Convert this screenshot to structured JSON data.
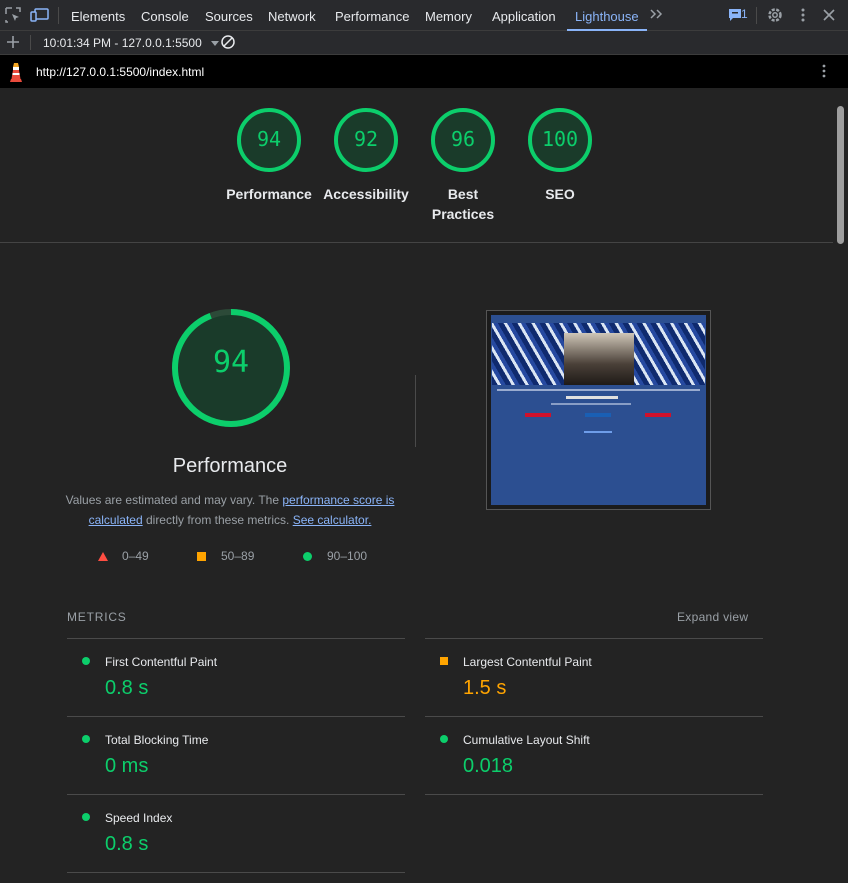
{
  "toolbar": {
    "tabs": [
      "Elements",
      "Console",
      "Sources",
      "Network",
      "Performance",
      "Memory",
      "Application",
      "Lighthouse"
    ],
    "active_tab": "Lighthouse",
    "issues_count": "1"
  },
  "report_bar": {
    "selected_report": "10:01:34 PM - 127.0.0.1:5500"
  },
  "url_bar": {
    "url": "http://127.0.0.1:5500/index.html"
  },
  "summary_scores": [
    {
      "score": "94",
      "label": "Performance",
      "label2": ""
    },
    {
      "score": "92",
      "label": "Accessibility",
      "label2": ""
    },
    {
      "score": "96",
      "label": "Best",
      "label2": "Practices"
    },
    {
      "score": "100",
      "label": "SEO",
      "label2": ""
    }
  ],
  "performance": {
    "score": "94",
    "score_fraction": 0.94,
    "title": "Performance",
    "desc_prefix": "Values are estimated and may vary. The ",
    "desc_link1": "performance score is calculated",
    "desc_middle": " directly from these metrics. ",
    "desc_link2": "See calculator."
  },
  "legend": {
    "fail": "0–49",
    "average": "50–89",
    "pass": "90–100"
  },
  "metrics": {
    "heading": "METRICS",
    "expand_label": "Expand view",
    "items": [
      {
        "name": "First Contentful Paint",
        "value": "0.8 s",
        "status": "pass"
      },
      {
        "name": "Largest Contentful Paint",
        "value": "1.5 s",
        "status": "average"
      },
      {
        "name": "Total Blocking Time",
        "value": "0 ms",
        "status": "pass"
      },
      {
        "name": "Cumulative Layout Shift",
        "value": "0.018",
        "status": "pass"
      },
      {
        "name": "Speed Index",
        "value": "0.8 s",
        "status": "pass"
      }
    ]
  },
  "colors": {
    "pass": "#0cce6b",
    "average": "#ffa400",
    "fail": "#ff4e42",
    "accent": "#8ab4f8"
  }
}
